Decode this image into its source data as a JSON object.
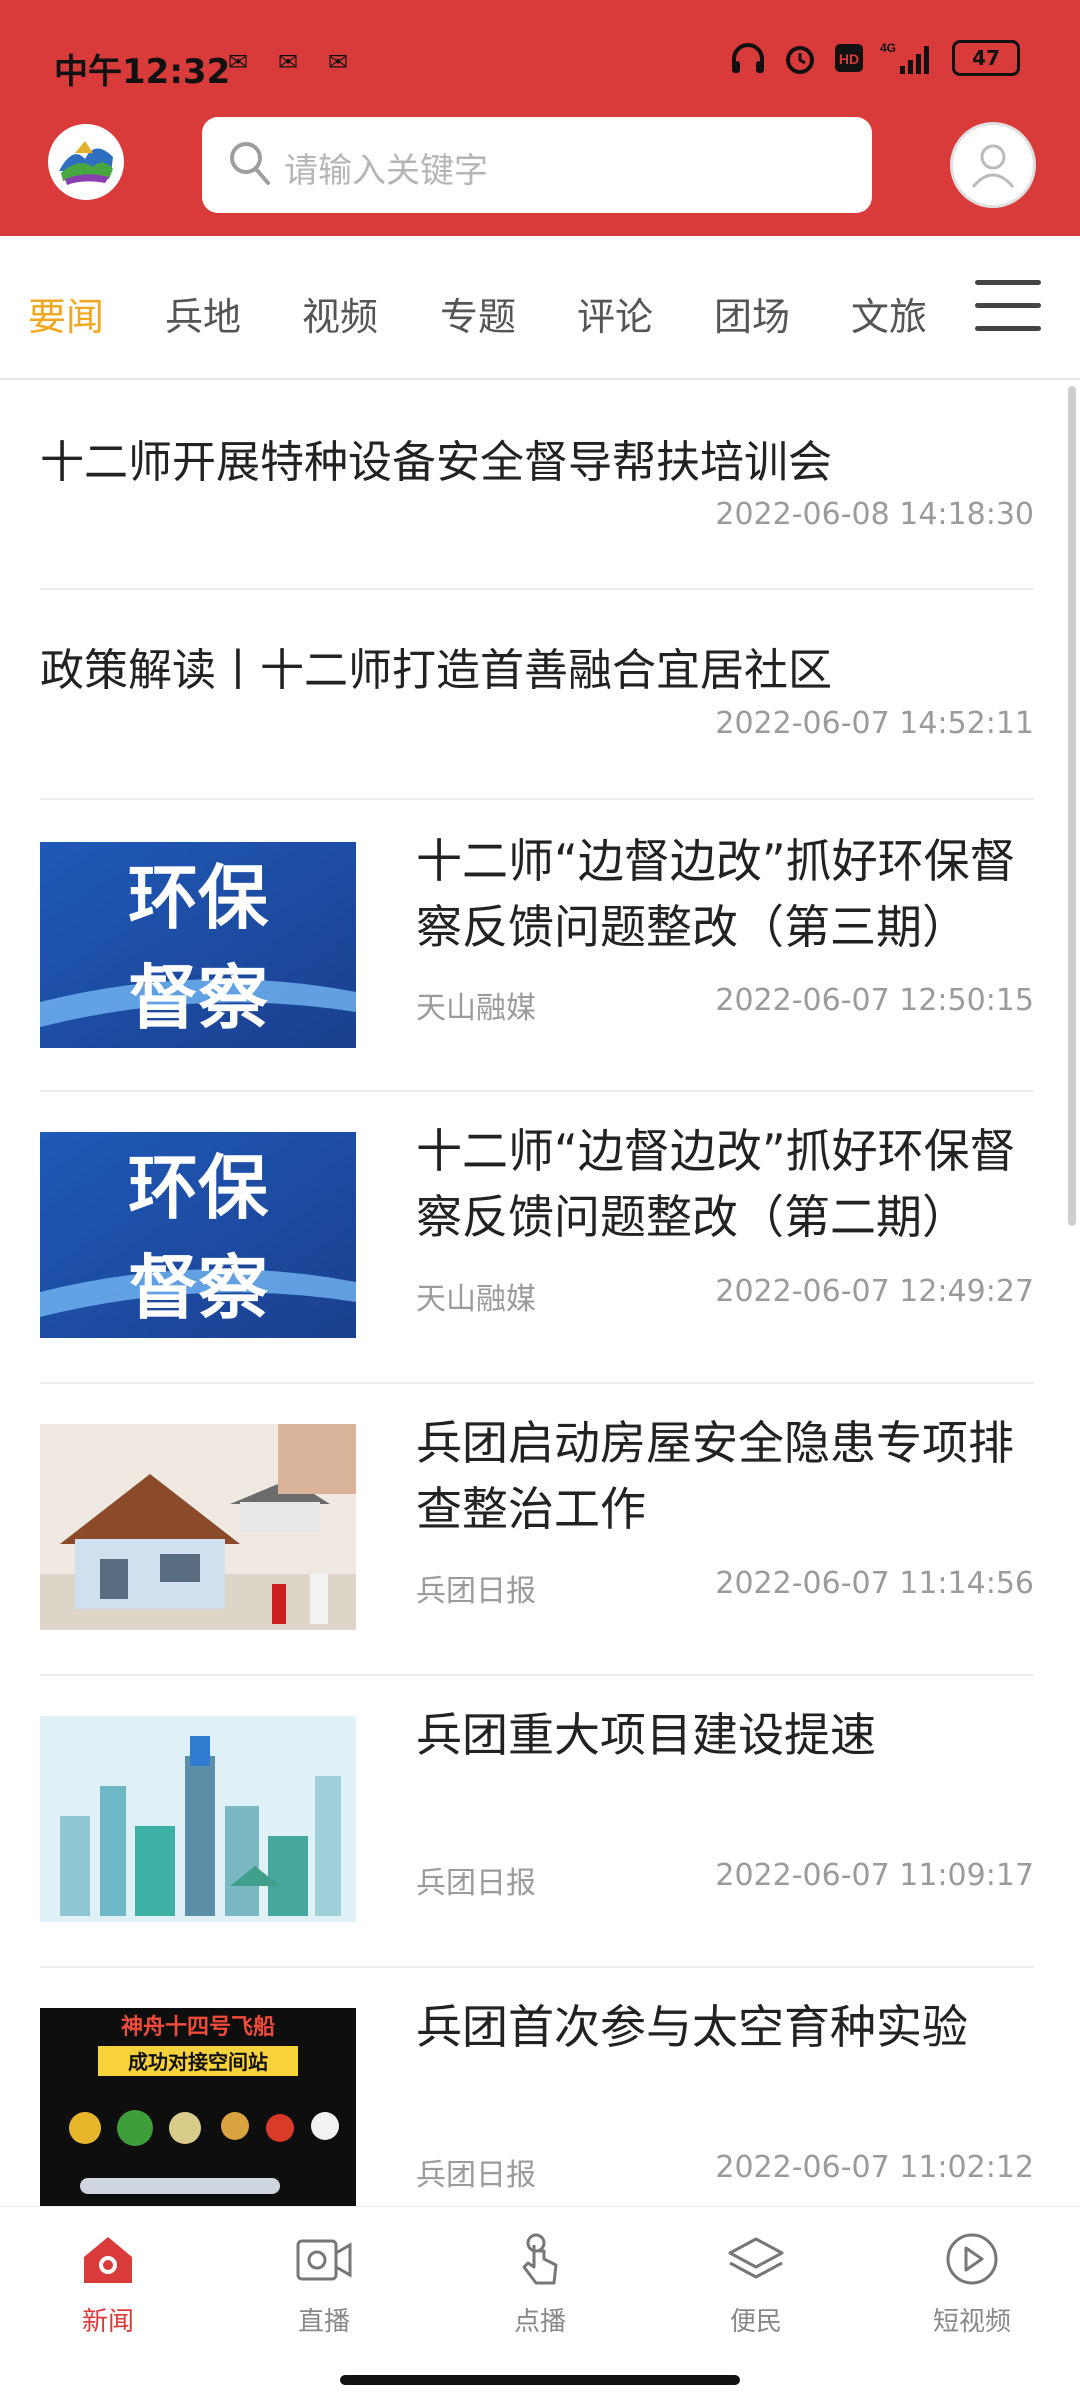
{
  "status_bar": {
    "time": "中午12:32",
    "mini_icons": [
      "notification-icon",
      "notification-icon",
      "notification-icon"
    ],
    "right_icons": [
      "headphones-icon",
      "alarm-icon",
      "hd-icon",
      "4g-signal-icon"
    ],
    "battery": "47"
  },
  "header": {
    "search_placeholder": "请输入关键字",
    "brand_color": "#d93a3a"
  },
  "tabs": {
    "items": [
      "要闻",
      "兵地",
      "视频",
      "专题",
      "评论",
      "团场",
      "文旅"
    ],
    "active_index": 0,
    "active_color": "#f1a71f"
  },
  "news": [
    {
      "title": "十二师开展特种设备安全督导帮扶培训会",
      "date": "2022-06-08 14:18:30"
    },
    {
      "title": "政策解读丨十二师打造首善融合宜居社区",
      "date": "2022-06-07 14:52:11"
    },
    {
      "title": "十二师“边督边改”抓好环保督察反馈问题整改（第三期）",
      "source": "天山融媒",
      "date": "2022-06-07 12:50:15",
      "thumb_text": [
        "环保",
        "督察"
      ]
    },
    {
      "title": "十二师“边督边改”抓好环保督察反馈问题整改（第二期）",
      "source": "天山融媒",
      "date": "2022-06-07 12:49:27",
      "thumb_text": [
        "环保",
        "督察"
      ]
    },
    {
      "title": "兵团启动房屋安全隐患专项排查整治工作",
      "source": "兵团日报",
      "date": "2022-06-07 11:14:56"
    },
    {
      "title": "兵团重大项目建设提速",
      "source": "兵团日报",
      "date": "2022-06-07 11:09:17"
    },
    {
      "title": "兵团首次参与太空育种实验",
      "source": "兵团日报",
      "date": "2022-06-07 11:02:12",
      "thumb_text": [
        "神舟十四号飞船",
        "成功对接空间站"
      ]
    }
  ],
  "bottom_nav": {
    "items": [
      "新闻",
      "直播",
      "点播",
      "便民",
      "短视频"
    ],
    "active_index": 0
  }
}
